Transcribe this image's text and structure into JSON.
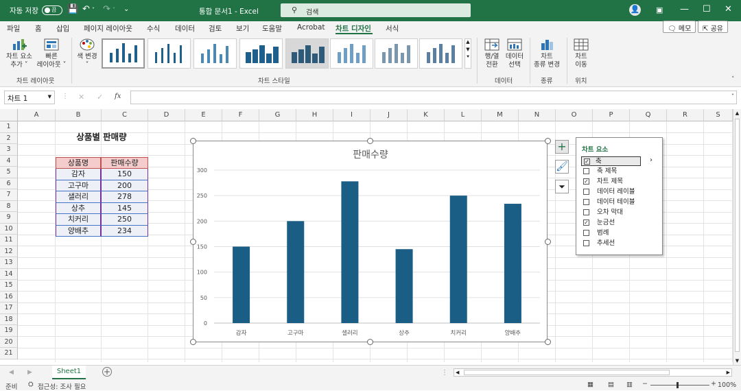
{
  "titlebar": {
    "autosave_label": "자동 저장",
    "autosave_state": "끔",
    "doc_title": "통합 문서1  -  Excel",
    "search_placeholder": "검색"
  },
  "menu": {
    "tabs": [
      "파일",
      "홈",
      "삽입",
      "페이지 레이아웃",
      "수식",
      "데이터",
      "검토",
      "보기",
      "도움말",
      "Acrobat",
      "차트 디자인",
      "서식"
    ],
    "active_tab": "차트 디자인",
    "memo_button": "메모",
    "share_button": "공유"
  },
  "ribbon": {
    "add_element": [
      "차트 요소",
      "추가 ˅"
    ],
    "quick_layout": [
      "빠른",
      "레이아웃 ˅"
    ],
    "change_color": [
      "색 변경",
      "˅"
    ],
    "group_layout": "차트 레이아웃",
    "group_styles": "차트 스타일",
    "switch_row_col": [
      "행/열",
      "전환"
    ],
    "select_data": [
      "데이터",
      "선택"
    ],
    "group_data": "데이터",
    "change_type": [
      "차트",
      "종류 변경"
    ],
    "group_type": "종류",
    "move_chart": [
      "차트",
      "이동"
    ],
    "group_location": "위치"
  },
  "formula_bar": {
    "name_box": "차트 1",
    "fx": "fx",
    "cancel": "✕",
    "enter": "✓",
    "content": ""
  },
  "grid": {
    "columns": [
      "A",
      "B",
      "C",
      "D",
      "E",
      "F",
      "G",
      "H",
      "I",
      "J",
      "K",
      "L",
      "M",
      "N",
      "O",
      "P",
      "Q",
      "R",
      "S"
    ],
    "rows": [
      "1",
      "2",
      "3",
      "4",
      "5",
      "6",
      "7",
      "8",
      "9",
      "10",
      "11",
      "12",
      "13",
      "14",
      "15",
      "16",
      "17",
      "18",
      "19",
      "20",
      "21"
    ]
  },
  "table": {
    "title": "상품별 판매량",
    "headers": [
      "상품명",
      "판매수량"
    ],
    "rows": [
      [
        "감자",
        "150"
      ],
      [
        "고구마",
        "200"
      ],
      [
        "샐러리",
        "278"
      ],
      [
        "상추",
        "145"
      ],
      [
        "치커리",
        "250"
      ],
      [
        "양배추",
        "234"
      ]
    ]
  },
  "chart_data": {
    "type": "bar",
    "title": "판매수량",
    "categories": [
      "감자",
      "고구마",
      "샐러리",
      "상추",
      "치커리",
      "양배추"
    ],
    "values": [
      150,
      200,
      278,
      145,
      250,
      234
    ],
    "yticks": [
      "0",
      "50",
      "100",
      "150",
      "200",
      "250",
      "300"
    ],
    "ylim": [
      0,
      300
    ],
    "grid": true,
    "legend": "none",
    "color": "#1b5e85"
  },
  "chart_elements_panel": {
    "title": "차트 요소",
    "items": [
      {
        "label": "축",
        "checked": true
      },
      {
        "label": "축 제목",
        "checked": false
      },
      {
        "label": "차트 제목",
        "checked": true
      },
      {
        "label": "데이터 레이블",
        "checked": false
      },
      {
        "label": "데이터 테이블",
        "checked": false
      },
      {
        "label": "오차 막대",
        "checked": false
      },
      {
        "label": "눈금선",
        "checked": true
      },
      {
        "label": "범례",
        "checked": false
      },
      {
        "label": "추세선",
        "checked": false
      }
    ]
  },
  "sheets": {
    "tabs": [
      "Sheet1"
    ],
    "active": "Sheet1"
  },
  "status": {
    "ready": "준비",
    "accessibility": "접근성: 조사 필요",
    "zoom": "100%"
  },
  "colors": {
    "accent": "#217346",
    "bar": "#1b5e85",
    "header_fill": "#f4cccc",
    "header_border": "#c0504d",
    "body_border": "#7030a0"
  }
}
